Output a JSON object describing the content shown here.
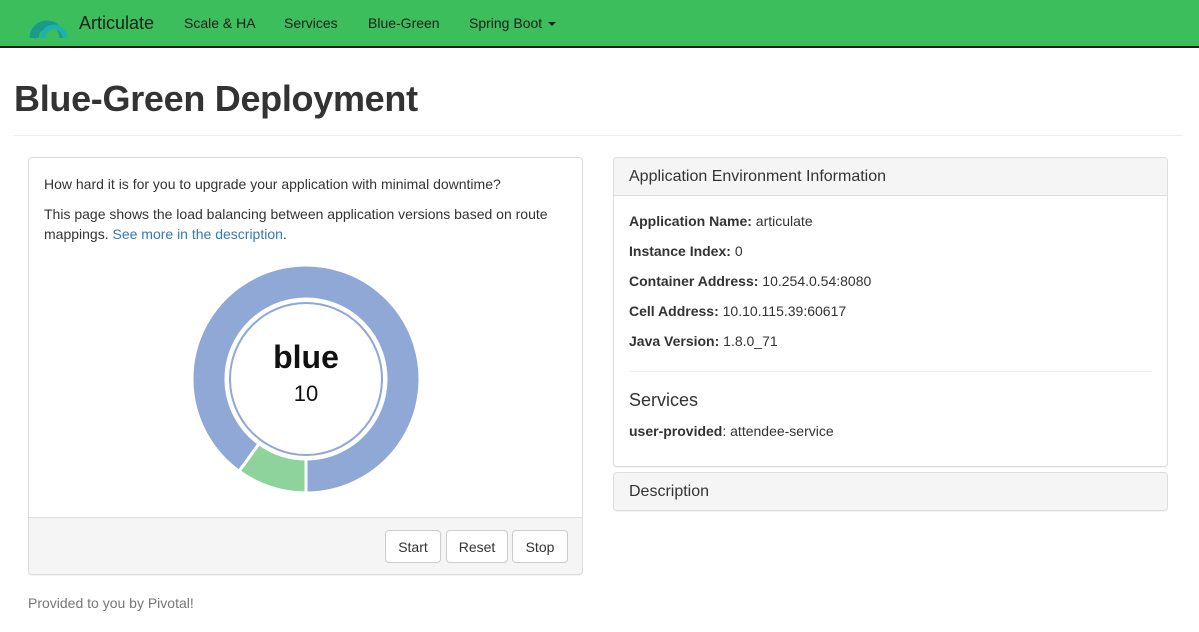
{
  "navbar": {
    "brand": "Articulate",
    "brand_icon": "pivotal-cloud-logo-icon",
    "items": [
      {
        "label": "Scale & HA"
      },
      {
        "label": "Services"
      },
      {
        "label": "Blue-Green"
      },
      {
        "label": "Spring Boot",
        "dropdown": true
      }
    ],
    "background_color": "#3dbe5c"
  },
  "page": {
    "title": "Blue-Green Deployment"
  },
  "left_panel": {
    "question": "How hard it is for you to upgrade your application with minimal downtime?",
    "description_prefix": "This page shows the load balancing between application versions based on route mappings. ",
    "description_link": "See more in the description",
    "description_suffix": ".",
    "buttons": {
      "start": "Start",
      "reset": "Reset",
      "stop": "Stop"
    }
  },
  "chart_data": {
    "type": "pie",
    "variant": "donut",
    "title": "",
    "center_label": "blue",
    "center_value": "10",
    "slices": [
      {
        "name": "blue",
        "value": 90,
        "color": "#8fa8d6"
      },
      {
        "name": "green",
        "value": 10,
        "color": "#8fd39c"
      }
    ],
    "start_angle": "bottom (6 o'clock), clockwise for green then blue"
  },
  "env_panel": {
    "heading": "Application Environment Information",
    "rows": [
      {
        "label": "Application Name:",
        "value": "articulate"
      },
      {
        "label": "Instance Index:",
        "value": "0"
      },
      {
        "label": "Container Address:",
        "value": "10.254.0.54:8080"
      },
      {
        "label": "Cell Address:",
        "value": "10.10.115.39:60617"
      },
      {
        "label": "Java Version:",
        "value": "1.8.0_71"
      }
    ],
    "services_title": "Services",
    "services": [
      {
        "type": "user-provided",
        "name": "attendee-service"
      }
    ]
  },
  "description_panel": {
    "heading": "Description"
  },
  "footer": {
    "text": "Provided to you by Pivotal!"
  }
}
